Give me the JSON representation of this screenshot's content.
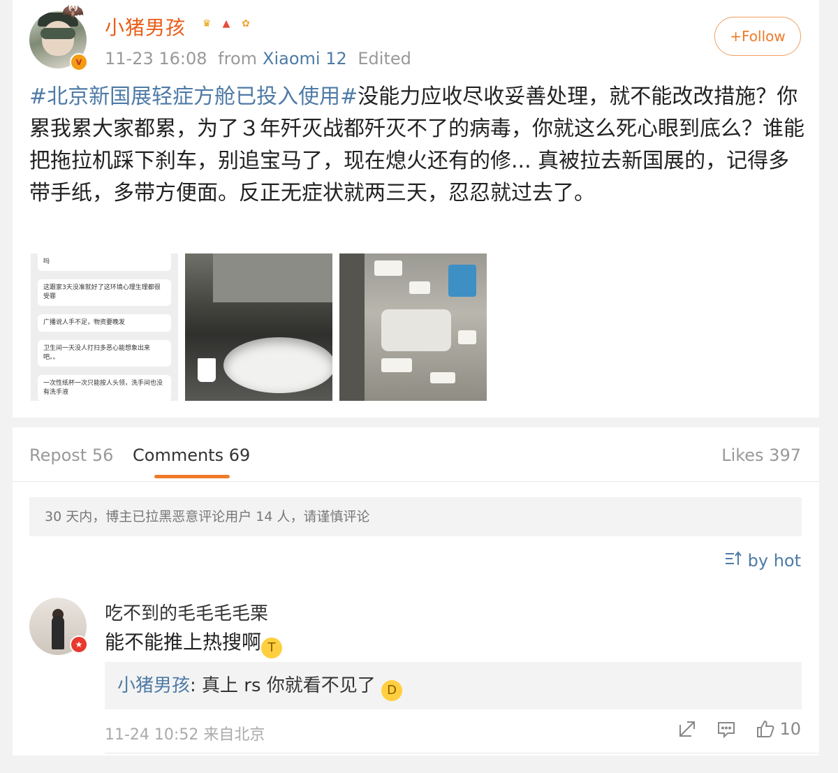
{
  "post": {
    "username": "小猪男孩",
    "timestamp": "11-23 16:08",
    "from_label": "from",
    "device": "Xiaomi 12",
    "edited": "Edited",
    "follow_label": "+Follow",
    "topic": "#北京新国展轻症方舱已投入使用#",
    "body": "没能力应收尽收妥善处理，就不能改改措施？你累我累大家都累，为了３年歼灭战都歼灭不了的病毒，你就这么死心眼到底么？谁能把拖拉机踩下刹车，别追宝马了，现在熄火还有的修... 真被拉去新国展的，记得多带手纸，多带方便面。反正无症状就两三天，忍忍就过去了。",
    "chat_thumb": {
      "messages": [
        "吗",
        "这跟家3天没准就好了这环境心理生理都很受罪",
        "广播说人手不足，物资要晚发",
        "卫生间一天没人打扫多恶心能想象出来吧。。",
        "一次性纸杯一次只能按人头领，洗手间也没有洗手液"
      ]
    }
  },
  "tabs": {
    "repost": "Repost 56",
    "comments": "Comments 69",
    "likes": "Likes 397"
  },
  "notice": "30 天内，博主已拉黑恶意评论用户 14 人，请谨慎评论",
  "sort_label": "by hot",
  "comment": {
    "username": "吃不到的毛毛毛毛栗",
    "text": "能不能推上热搜啊",
    "reply_name": "小猪男孩",
    "reply_text": ": 真上 rs 你就看不见了",
    "timestamp": "11-24 10:52",
    "location": "来自北京",
    "like_count": "10"
  },
  "colors": {
    "accent_orange": "#f07a27",
    "link_blue": "#4e7aa6"
  }
}
